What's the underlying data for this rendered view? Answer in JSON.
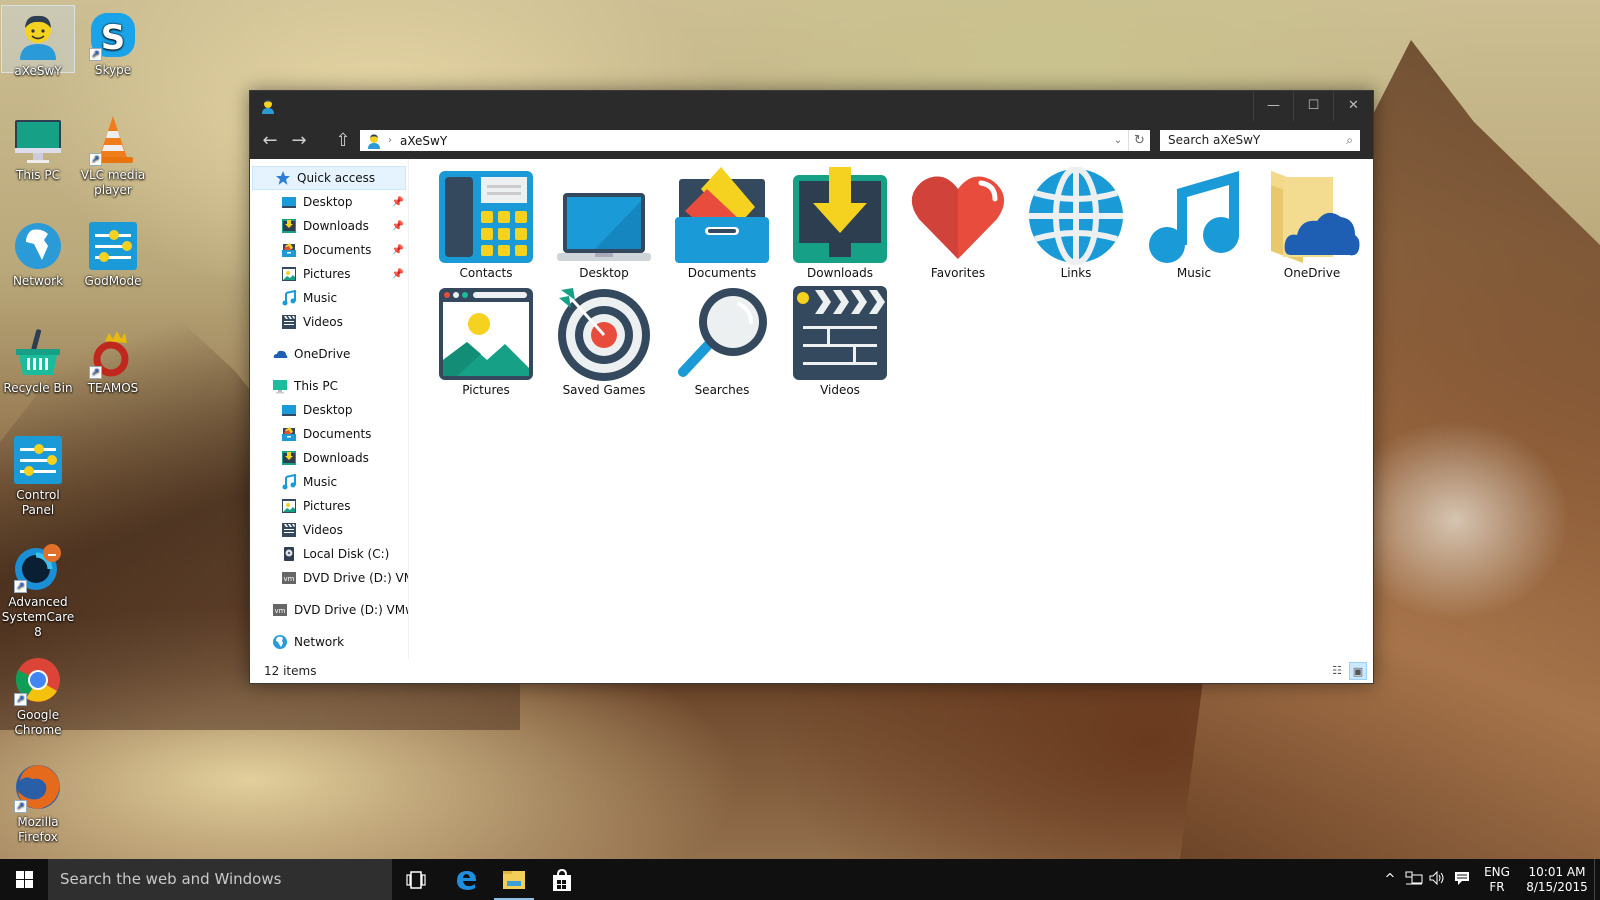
{
  "desktop": {
    "icons": [
      {
        "label": "aXeSwY",
        "icon": "user-folder-icon",
        "selected": true
      },
      {
        "label": "Skype",
        "icon": "skype-icon",
        "shortcut": true
      },
      {
        "label": "This PC",
        "icon": "monitor-icon"
      },
      {
        "label": "VLC media player",
        "icon": "vlc-cone-icon",
        "shortcut": true
      },
      {
        "label": "Network",
        "icon": "globe-icon"
      },
      {
        "label": "GodMode",
        "icon": "sliders-icon"
      },
      {
        "label": "Recycle Bin",
        "icon": "basket-icon"
      },
      {
        "label": "TEAMOS",
        "icon": "crown-ring-icon",
        "shortcut": true
      },
      {
        "label": "Control Panel",
        "icon": "sliders-icon"
      },
      {
        "label": "Advanced SystemCare 8",
        "icon": "systemcare-icon",
        "shortcut": true
      },
      {
        "label": "Google Chrome",
        "icon": "chrome-icon",
        "shortcut": true
      },
      {
        "label": "Mozilla Firefox",
        "icon": "firefox-icon",
        "shortcut": true
      }
    ]
  },
  "window": {
    "title_icon": "user-folder-icon",
    "controls": {
      "minimize": "—",
      "maximize": "☐",
      "close": "✕"
    },
    "nav": {
      "back": "←",
      "forward": "→",
      "up": "⇧"
    },
    "address": {
      "crumb": "aXeSwY",
      "separator": "›",
      "dropdown": "⌄",
      "refresh": "↻"
    },
    "search": {
      "placeholder": "Search aXeSwY",
      "icon": "⌕"
    },
    "navpane": {
      "quick_access": {
        "label": "Quick access",
        "items": [
          {
            "label": "Desktop",
            "pinned": true
          },
          {
            "label": "Downloads",
            "pinned": true
          },
          {
            "label": "Documents",
            "pinned": true
          },
          {
            "label": "Pictures",
            "pinned": true
          },
          {
            "label": "Music"
          },
          {
            "label": "Videos"
          }
        ]
      },
      "onedrive": "OneDrive",
      "this_pc": {
        "label": "This PC",
        "items": [
          {
            "label": "Desktop"
          },
          {
            "label": "Documents"
          },
          {
            "label": "Downloads"
          },
          {
            "label": "Music"
          },
          {
            "label": "Pictures"
          },
          {
            "label": "Videos"
          },
          {
            "label": "Local Disk (C:)"
          },
          {
            "label": "DVD Drive (D:) VMware Tools"
          }
        ]
      },
      "dvd": "DVD Drive (D:) VMware Tools",
      "network": "Network",
      "pin_glyph": "📌"
    },
    "items": [
      {
        "label": "Contacts"
      },
      {
        "label": "Desktop"
      },
      {
        "label": "Documents"
      },
      {
        "label": "Downloads"
      },
      {
        "label": "Favorites"
      },
      {
        "label": "Links"
      },
      {
        "label": "Music"
      },
      {
        "label": "OneDrive"
      },
      {
        "label": "Pictures"
      },
      {
        "label": "Saved Games"
      },
      {
        "label": "Searches"
      },
      {
        "label": "Videos"
      }
    ],
    "status": {
      "count": "12 items",
      "view_details": "☷",
      "view_large": "▣",
      "active_view": "large-icons"
    }
  },
  "taskbar": {
    "search_placeholder": "Search the web and Windows",
    "tray": {
      "chevron": "^",
      "lang_top": "ENG",
      "lang_bottom": "FR",
      "time": "10:01 AM",
      "date": "8/15/2015"
    }
  },
  "colors": {
    "titlebar": "#2b2b2b",
    "taskbar": "#101010",
    "selection": "#e5f3ff",
    "icon_blue": "#1a9ad6",
    "icon_dark": "#34495e",
    "icon_yellow": "#f5d21f",
    "icon_red": "#e74c3c",
    "icon_green": "#16a085"
  }
}
